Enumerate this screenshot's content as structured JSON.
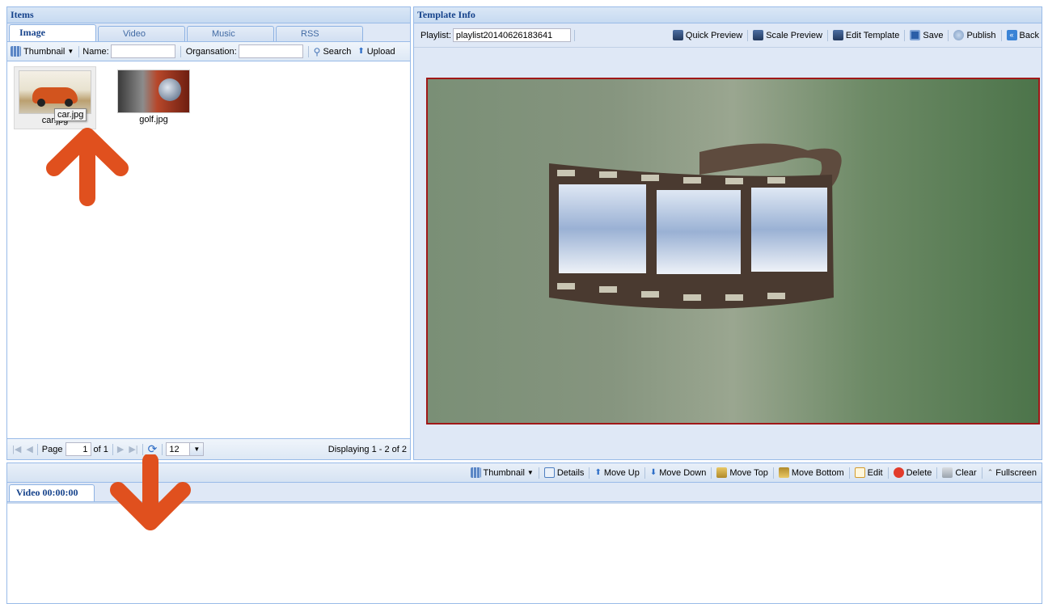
{
  "items_panel": {
    "title": "Items",
    "tabs": [
      {
        "label": "Image",
        "active": true
      },
      {
        "label": "Video",
        "active": false
      },
      {
        "label": "Music",
        "active": false
      },
      {
        "label": "RSS",
        "active": false
      }
    ],
    "toolbar": {
      "view_label": "Thumbnail",
      "name_label": "Name:",
      "name_value": "",
      "org_label": "Organsation:",
      "org_value": "",
      "search_label": "Search",
      "upload_label": "Upload"
    },
    "thumbnails": [
      {
        "caption": "car.jpg",
        "tooltip": "car.jpg"
      },
      {
        "caption": "golf.jpg"
      }
    ],
    "pager": {
      "page_label": "Page",
      "page_value": "1",
      "of_label": "of 1",
      "page_size": "12",
      "display_text": "Displaying 1 - 2 of 2"
    }
  },
  "template_panel": {
    "title": "Template Info",
    "playlist_label": "Playlist:",
    "playlist_value": "playlist20140626183641",
    "actions": [
      "Quick Preview",
      "Scale Preview",
      "Edit Template",
      "Save",
      "Publish",
      "Back"
    ]
  },
  "bottom_panel": {
    "actions": [
      "Thumbnail",
      "Details",
      "Move Up",
      "Move Down",
      "Move Top",
      "Move Bottom",
      "Edit",
      "Delete",
      "Clear",
      "Fullscreen"
    ],
    "tab_label": "Video 00:00:00"
  },
  "colors": {
    "accent": "#15428b",
    "border": "#99bbe8",
    "arrow": "#e0501e",
    "preview_border": "#a01818"
  }
}
